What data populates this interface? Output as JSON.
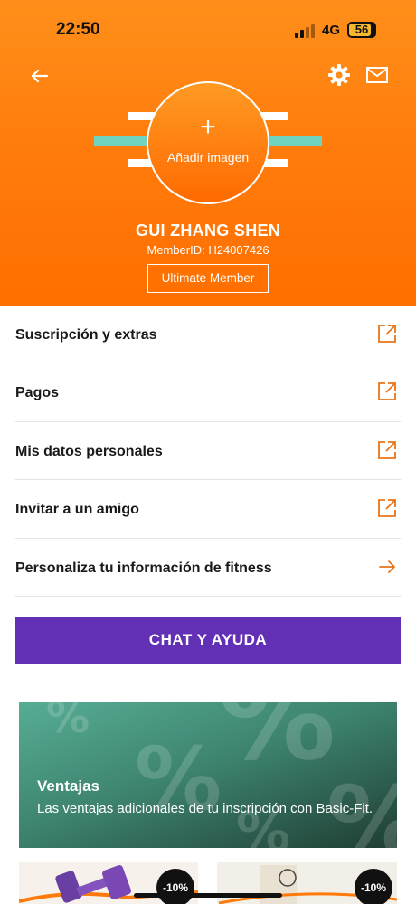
{
  "status": {
    "time": "22:50",
    "network": "4G",
    "battery": "56"
  },
  "profile": {
    "add_image_label": "Añadir imagen",
    "name": "GUI ZHANG SHEN",
    "member_id": "MemberID: H24007426",
    "membership": "Ultimate Member"
  },
  "menu": {
    "items": [
      {
        "label": "Suscripción y extras",
        "icon": "external-link-icon"
      },
      {
        "label": "Pagos",
        "icon": "external-link-icon"
      },
      {
        "label": "Mis datos personales",
        "icon": "external-link-icon"
      },
      {
        "label": "Invitar a un amigo",
        "icon": "external-link-icon"
      },
      {
        "label": "Personaliza tu información de fitness",
        "icon": "arrow-right-icon"
      }
    ]
  },
  "chat_button": {
    "label": "CHAT Y AYUDA"
  },
  "promo": {
    "title": "Ventajas",
    "description": "Las ventajas adicionales de tu inscripción con Basic-Fit."
  },
  "tiles": [
    {
      "discount": "-10%"
    },
    {
      "discount": "-10%"
    }
  ],
  "colors": {
    "brand_orange": "#ff7a0a",
    "accent_purple": "#6230b4",
    "icon_orange": "#e8751a",
    "promo_green": "#3e8571"
  }
}
